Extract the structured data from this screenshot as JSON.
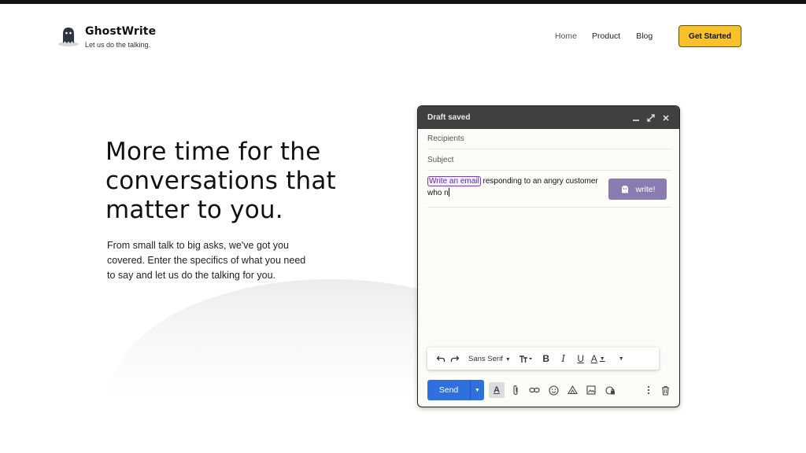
{
  "brand": {
    "name": "GhostWrite",
    "tagline": "Let us do the talking."
  },
  "nav": {
    "items": [
      "Home",
      "Product",
      "Blog"
    ],
    "cta": "Get Started"
  },
  "hero": {
    "title": "More time for the conversations that matter to you.",
    "description": "From small talk to big asks, we've got you covered. Enter the specifics of what you need to say and let us do the talking for you."
  },
  "compose": {
    "title": "Draft saved",
    "recipients_placeholder": "Recipients",
    "subject_placeholder": "Subject",
    "prompt_highlight": "Write an email",
    "prompt_rest": " responding to an angry customer who n",
    "write_button": "write!",
    "font_name": "Sans Serif",
    "send_label": "Send"
  },
  "colors": {
    "cta": "#f8c12a",
    "send": "#2f6fde",
    "write_button": "#8a7cb3",
    "compose_header": "#404040",
    "highlight": "#7a3fb8"
  }
}
